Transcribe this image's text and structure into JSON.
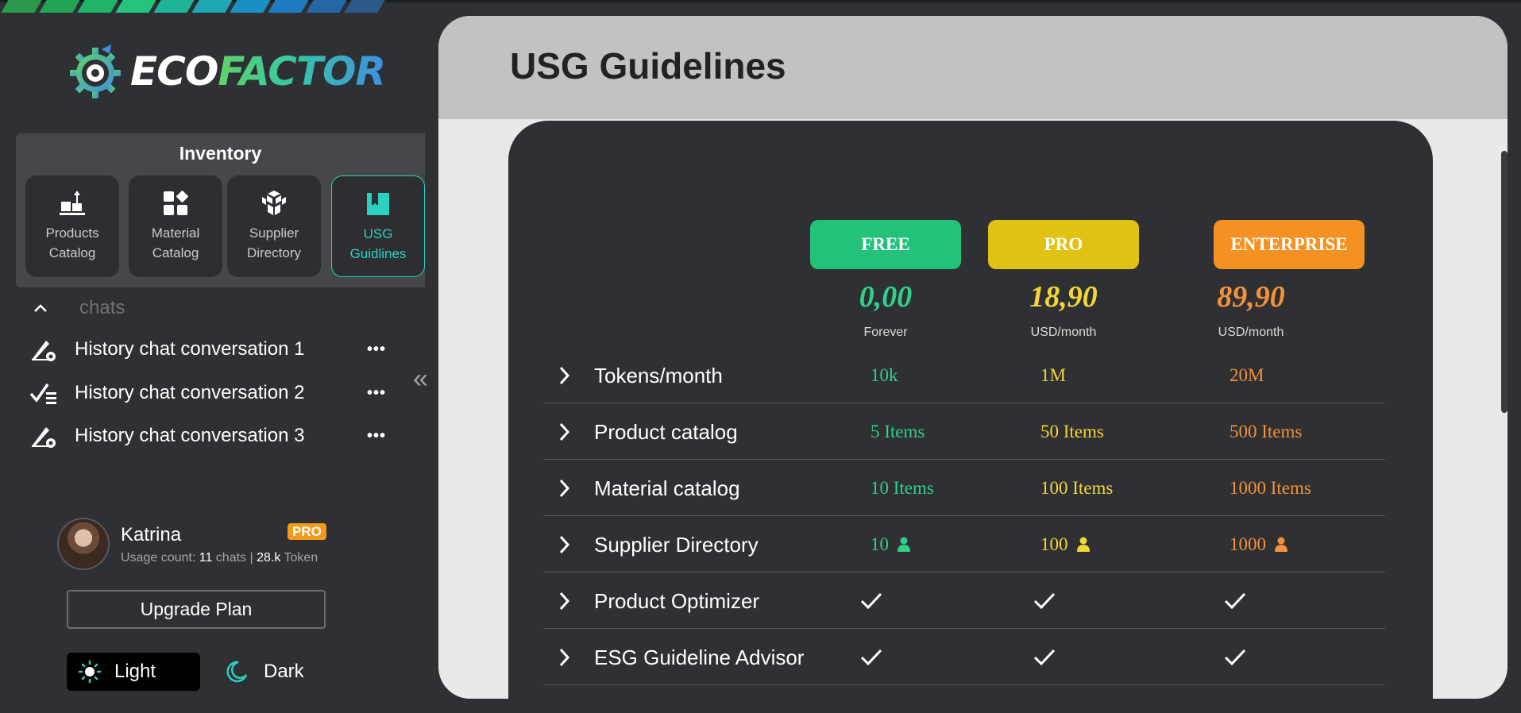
{
  "brand": {
    "eco": "ECO",
    "factor": "FACTOR"
  },
  "stripe_colors": [
    "#2a9a4a",
    "#22a356",
    "#1fb466",
    "#25c47e",
    "#1fb49a",
    "#1fa6b4",
    "#1a8fc4",
    "#1f7bc0",
    "#2467a6",
    "#2b5a8a"
  ],
  "sidebar": {
    "inventory_title": "Inventory",
    "inventory_items": [
      {
        "line1": "Products",
        "line2": "Catalog",
        "icon": "products-catalog-icon"
      },
      {
        "line1": "Material",
        "line2": "Catalog",
        "icon": "material-catalog-icon"
      },
      {
        "line1": "Supplier",
        "line2": "Directory",
        "icon": "supplier-directory-icon"
      },
      {
        "line1": "USG",
        "line2": "Guidlines",
        "icon": "usg-guidelines-icon",
        "active": true
      }
    ],
    "chats_label": "chats",
    "chats": [
      {
        "label": "History chat conversation 1",
        "icon": "edit-settings-icon"
      },
      {
        "label": "History chat conversation 2",
        "icon": "checklist-icon"
      },
      {
        "label": "History chat conversation 3",
        "icon": "edit-settings-icon"
      }
    ],
    "more": "•••",
    "collapse": "«"
  },
  "user": {
    "name": "Katrina",
    "badge": "PRO",
    "usage_prefix": "Usage count:",
    "chats_count": "11",
    "chats_unit": "chats",
    "separator": "|",
    "tokens_count": "28.k",
    "tokens_unit": "Token"
  },
  "upgrade_label": "Upgrade Plan",
  "theme": {
    "light": "Light",
    "dark": "Dark"
  },
  "page": {
    "title": "USG Guidelines"
  },
  "plans": [
    {
      "name": "FREE",
      "price": "0,00",
      "period": "Forever",
      "color": "#22c27a",
      "text_color": "#2fd08a"
    },
    {
      "name": "PRO",
      "price": "18,90",
      "period": "USD/month",
      "color": "#e0c215",
      "text_color": "#f2d536"
    },
    {
      "name": "ENTERPRISE",
      "price": "89,90",
      "period": "USD/month",
      "color": "#f39122",
      "text_color": "#f3923a"
    }
  ],
  "features": [
    {
      "name": "Tokens/month",
      "values": [
        "10k",
        "1M",
        "20M"
      ],
      "kind": "text"
    },
    {
      "name": "Product catalog",
      "values": [
        "5 Items",
        "50 Items",
        "500 Items"
      ],
      "kind": "text"
    },
    {
      "name": "Material catalog",
      "values": [
        "10 Items",
        "100 Items",
        "1000 Items"
      ],
      "kind": "text"
    },
    {
      "name": "Supplier Directory",
      "values": [
        "10",
        "100",
        "1000"
      ],
      "kind": "users"
    },
    {
      "name": "Product Optimizer",
      "values": [
        "check",
        "check",
        "check"
      ],
      "kind": "check"
    },
    {
      "name": "ESG Guideline Advisor",
      "values": [
        "check",
        "check",
        "check"
      ],
      "kind": "check"
    }
  ]
}
